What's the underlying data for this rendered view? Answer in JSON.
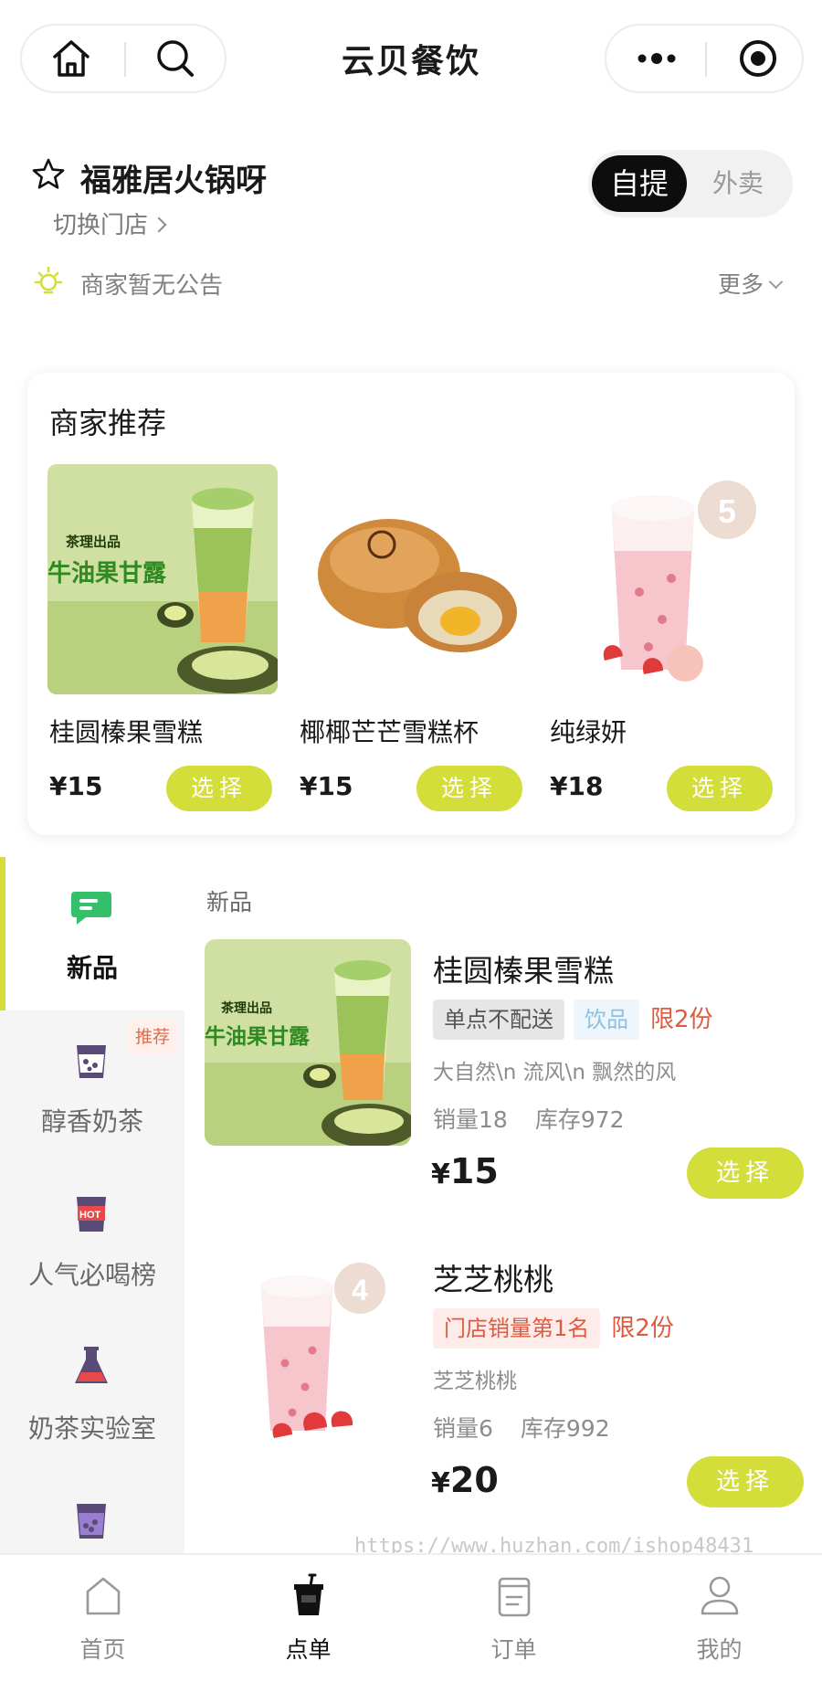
{
  "header": {
    "title": "云贝餐饮",
    "left_icons": [
      "home-icon",
      "search-icon"
    ],
    "right_icons": [
      "more-icon",
      "target-icon"
    ]
  },
  "store": {
    "name": "福雅居火锅呀",
    "switch_label": "切换门店",
    "mode_options": [
      "自提",
      "外卖"
    ],
    "mode_selected": "自提",
    "notice": "商家暂无公告",
    "more_label": "更多"
  },
  "recommend": {
    "title": "商家推荐",
    "items": [
      {
        "name": "桂圆榛果雪糕",
        "price": "¥15",
        "button": "选择"
      },
      {
        "name": "椰椰芒芒雪糕杯",
        "price": "¥15",
        "button": "选择"
      },
      {
        "name": "纯绿妍",
        "price": "¥18",
        "button": "选择"
      }
    ]
  },
  "categories": [
    {
      "label": "新品",
      "icon": "chat-bubble-icon",
      "active": true
    },
    {
      "label": "醇香奶茶",
      "icon": "milk-tea-icon",
      "badge": "推荐"
    },
    {
      "label": "人气必喝榜",
      "icon": "hot-cup-icon"
    },
    {
      "label": "奶茶实验室",
      "icon": "flask-icon"
    },
    {
      "label": "",
      "icon": "purple-cup-icon"
    }
  ],
  "section_title": "新品",
  "products": [
    {
      "name": "桂圆榛果雪糕",
      "tags": [
        "单点不配送",
        "饮品"
      ],
      "limit": "限2份",
      "desc": "大自然\\n 流风\\n 飘然的风",
      "sales": "销量18",
      "stock": "库存972",
      "price_symbol": "¥",
      "price": "15",
      "button": "选择"
    },
    {
      "name": "芝芝桃桃",
      "tags": [
        "门店销量第1名"
      ],
      "limit": "限2份",
      "desc": "芝芝桃桃",
      "sales": "销量6",
      "stock": "库存992",
      "price_symbol": "¥",
      "price": "20",
      "button": "选择"
    }
  ],
  "watermark": "https://www.huzhan.com/ishop48431",
  "tabbar": [
    {
      "label": "首页",
      "icon": "home-tab-icon"
    },
    {
      "label": "点单",
      "icon": "cup-tab-icon",
      "active": true
    },
    {
      "label": "订单",
      "icon": "order-tab-icon"
    },
    {
      "label": "我的",
      "icon": "user-tab-icon"
    }
  ],
  "colors": {
    "accent": "#d4de3a",
    "toggle_active_bg": "#0d0d0d",
    "tag_red": "#e05a3f",
    "tag_blue": "#8fc0e0",
    "badge_text": "#e46b4a"
  }
}
